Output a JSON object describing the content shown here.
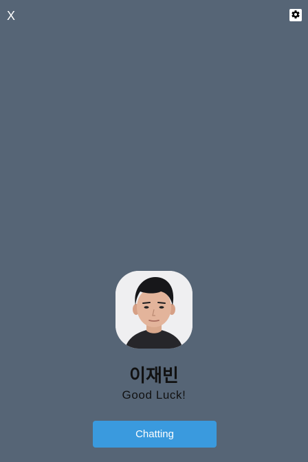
{
  "window": {
    "close_label": "X",
    "settings_icon": "gear-icon"
  },
  "profile": {
    "name": "이재빈",
    "status_message": "Good Luck!",
    "avatar_icon": "profile-photo"
  },
  "actions": {
    "chat_label": "Chatting"
  },
  "colors": {
    "background": "#566576",
    "button": "#3a9ade",
    "button_text": "#ffffff",
    "text": "#111111"
  }
}
